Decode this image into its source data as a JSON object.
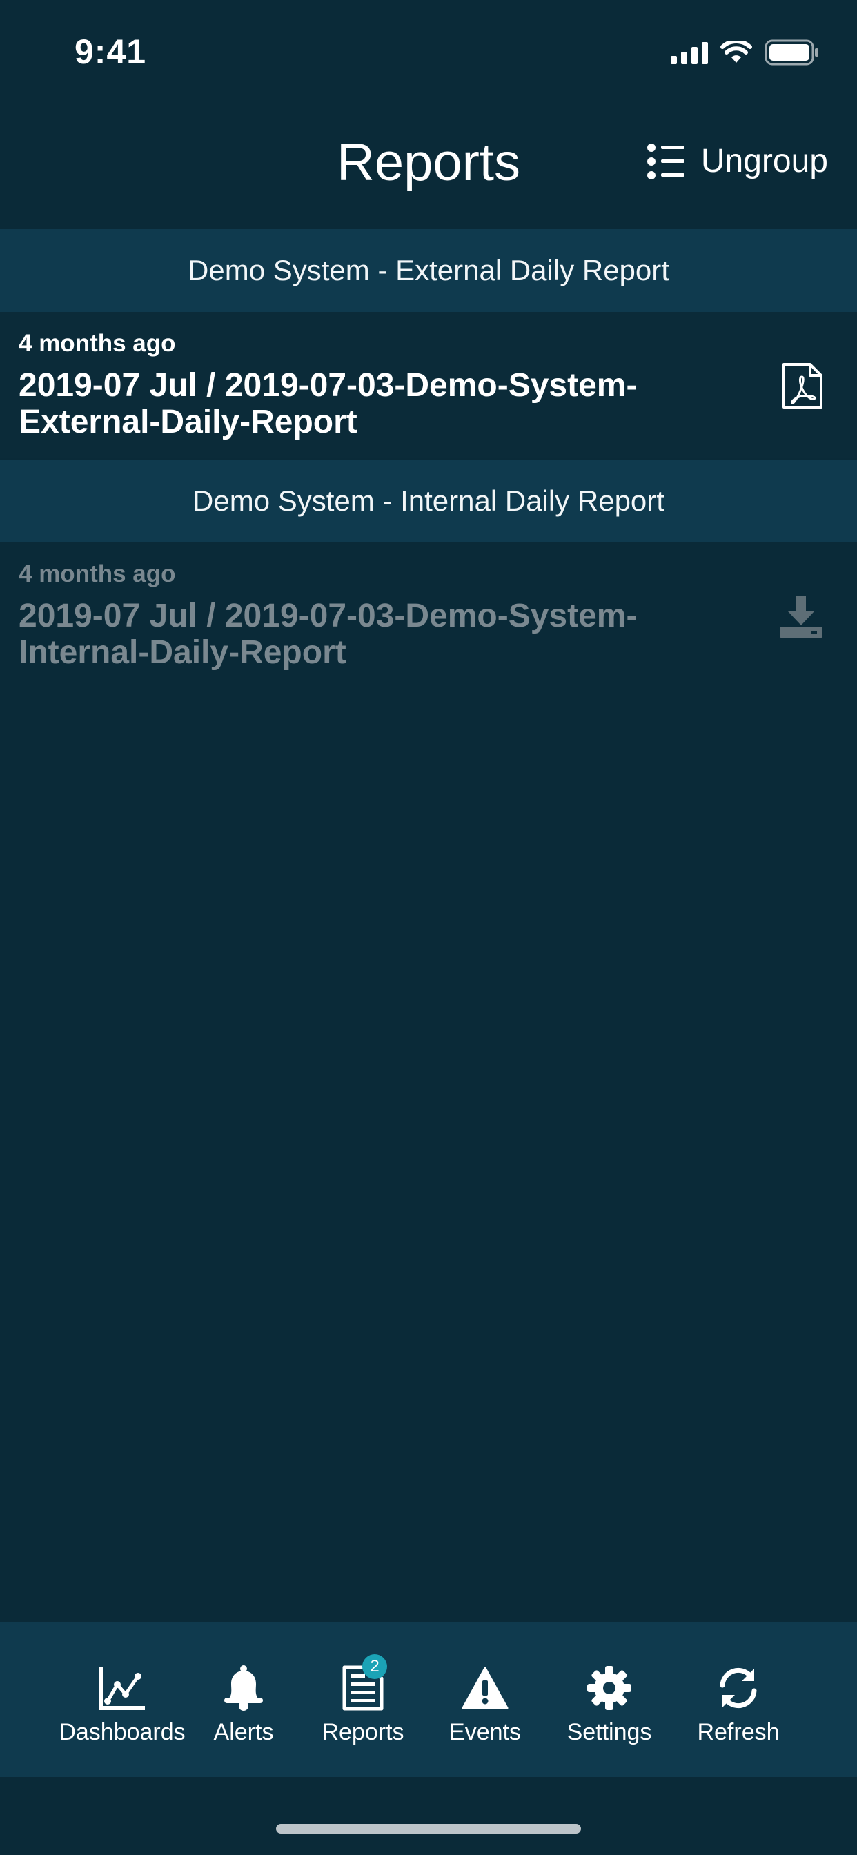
{
  "status_bar": {
    "time": "9:41"
  },
  "nav": {
    "title": "Reports",
    "ungroup_label": "Ungroup"
  },
  "sections": [
    {
      "header": "Demo System - External Daily Report",
      "reports": [
        {
          "time_ago": "4 months ago",
          "title": "2019-07 Jul / 2019-07-03-Demo-System-External-Daily-Report",
          "icon": "pdf-icon",
          "state": "downloaded"
        }
      ]
    },
    {
      "header": "Demo System - Internal Daily Report",
      "reports": [
        {
          "time_ago": "4 months ago",
          "title": "2019-07 Jul / 2019-07-03-Demo-System-Internal-Daily-Report",
          "icon": "download-icon",
          "state": "not-downloaded"
        }
      ]
    }
  ],
  "tabs": [
    {
      "label": "Dashboards",
      "icon": "chart-line-icon"
    },
    {
      "label": "Alerts",
      "icon": "bell-icon"
    },
    {
      "label": "Reports",
      "icon": "document-icon",
      "badge": "2"
    },
    {
      "label": "Events",
      "icon": "warning-icon"
    },
    {
      "label": "Settings",
      "icon": "gear-icon"
    },
    {
      "label": "Refresh",
      "icon": "refresh-icon"
    }
  ],
  "colors": {
    "background": "#0a2a38",
    "section_header": "#0f3a4e",
    "tab_bar": "#0f3a4e",
    "badge": "#1ba3b6",
    "dimmed_text": "#7a8890"
  }
}
